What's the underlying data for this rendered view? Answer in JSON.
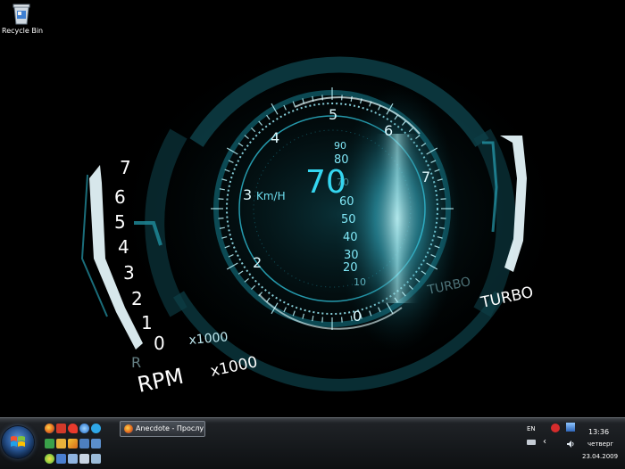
{
  "desktop": {
    "icons": [
      {
        "label": "Recycle Bin",
        "icon": "recycle-bin-icon"
      }
    ]
  },
  "wallpaper": {
    "speed_value": "70",
    "speed_unit": "Km/H",
    "speed_scale": [
      "90",
      "80",
      "70",
      "60",
      "50",
      "40",
      "30",
      "20",
      "10"
    ],
    "rpm_scale": [
      "7",
      "6",
      "5",
      "4",
      "3",
      "2",
      "1",
      "0"
    ],
    "dial_numbers": [
      "5",
      "6",
      "4",
      "3",
      "7",
      "2",
      "0"
    ],
    "rpm_label": "RPM",
    "rpm_multiplier": "x1000",
    "rpm_multiplier_small": "x1000",
    "turbo_label": "TURBO",
    "turbo_label_ghost": "TURBO",
    "gear_marker": "R",
    "accent_color": "#35d6f0"
  },
  "taskbar": {
    "start_icon": "windows-logo-icon",
    "quick_launch": [
      "firefox-icon",
      "media-player-icon",
      "opera-icon",
      "internet-explorer-icon",
      "skype-icon",
      "calendar-icon",
      "folder-icon",
      "flash-icon",
      "monitor-icon",
      "network-icon",
      "icq-icon",
      "paint-icon",
      "notepad-icon",
      "window-icon",
      "document-icon"
    ],
    "task_item": {
      "label": "Anecdote - Прослу...",
      "icon": "firefox-icon"
    },
    "tray": {
      "language": "EN",
      "time": "13:36",
      "weekday": "четверг",
      "date": "23.04.2009",
      "collapse_arrow": "‹"
    }
  }
}
